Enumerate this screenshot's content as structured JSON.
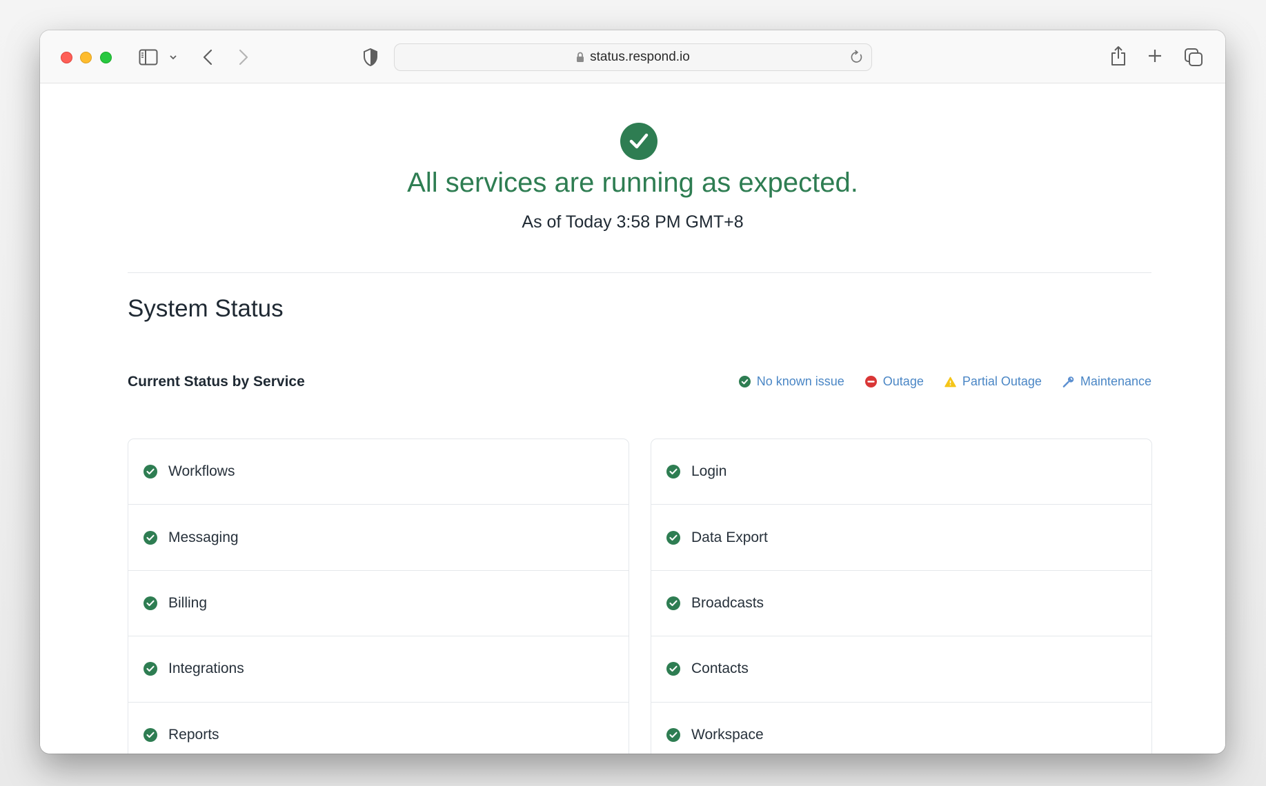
{
  "browser": {
    "url": "status.respond.io",
    "icons": [
      "sidebar-icon",
      "chevron-down-icon",
      "back-icon",
      "forward-icon",
      "privacy-shield-icon",
      "lock-icon",
      "reload-icon",
      "share-icon",
      "new-tab-icon",
      "tab-overview-icon"
    ]
  },
  "hero": {
    "icon": "check-circle-icon",
    "title": "All services are running as expected.",
    "subtitle": "As of Today 3:58 PM GMT+8"
  },
  "section": {
    "title": "System Status",
    "subtitle": "Current Status by Service"
  },
  "legend": [
    {
      "label": "No known issue",
      "icon": "check-circle-icon",
      "color": "#2e7d52"
    },
    {
      "label": "Outage",
      "icon": "minus-circle-icon",
      "color": "#d93636"
    },
    {
      "label": "Partial Outage",
      "icon": "warning-triangle-icon",
      "color": "#f5c518"
    },
    {
      "label": "Maintenance",
      "icon": "wrench-icon",
      "color": "#5b8fd0"
    }
  ],
  "services": {
    "left": [
      {
        "name": "Workflows",
        "status": "No known issue"
      },
      {
        "name": "Messaging",
        "status": "No known issue"
      },
      {
        "name": "Billing",
        "status": "No known issue"
      },
      {
        "name": "Integrations",
        "status": "No known issue"
      },
      {
        "name": "Reports",
        "status": "No known issue"
      }
    ],
    "right": [
      {
        "name": "Login",
        "status": "No known issue"
      },
      {
        "name": "Data Export",
        "status": "No known issue"
      },
      {
        "name": "Broadcasts",
        "status": "No known issue"
      },
      {
        "name": "Contacts",
        "status": "No known issue"
      },
      {
        "name": "Workspace",
        "status": "No known issue"
      }
    ]
  },
  "colors": {
    "ok": "#2e7d52",
    "legend_text": "#4a86c5",
    "heading": "#1f2933"
  }
}
